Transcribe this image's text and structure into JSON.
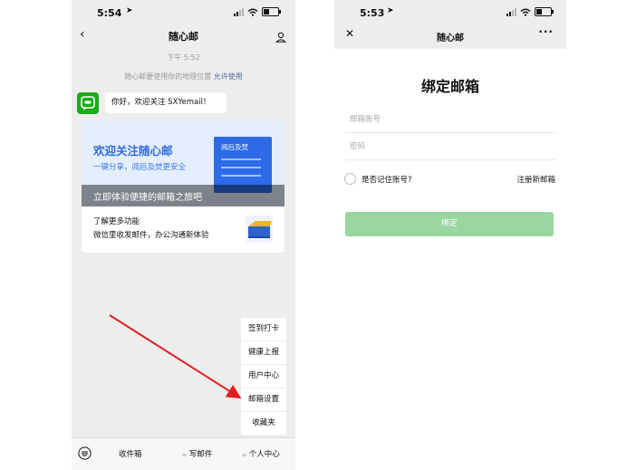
{
  "left_phone": {
    "status": {
      "time": "5:54"
    },
    "nav": {
      "title": "随心邮",
      "back_icon": "chevron-left-icon",
      "user_icon": "person-icon"
    },
    "chat": {
      "timestamp": "下午 5:52",
      "notice": "随心邮要使用你的地理位置",
      "notice_link": "允许使用",
      "greeting": "你好，欢迎关注 SXYemail！",
      "card": {
        "title": "欢迎关注随心邮",
        "subtitle": "一键分享，阅后及焚更安全",
        "doc_tag": "阅后及焚",
        "strip": "立即体验便捷的邮箱之旅吧",
        "line1": "了解更多功能",
        "line2": "微信里收发邮件，办公沟通新体验"
      }
    },
    "menu": [
      "签到打卡",
      "健康上报",
      "用户中心",
      "邮箱设置",
      "收藏夹"
    ],
    "bottom_tabs": [
      "收件箱",
      "写邮件",
      "个人中心"
    ],
    "colors": {
      "arrow": "#e02020",
      "app_green": "#1aad19",
      "brand_blue": "#2f6be0"
    }
  },
  "right_phone": {
    "status": {
      "time": "5:53"
    },
    "nav": {
      "title": "随心邮",
      "close_icon": "close-icon",
      "more_icon": "more-icon"
    },
    "form": {
      "title": "绑定邮箱",
      "account_placeholder": "邮箱账号",
      "password_placeholder": "密码",
      "remember_label": "是否记住账号?",
      "register_link": "注册新邮箱",
      "bind_button": "绑定"
    },
    "colors": {
      "button": "#99d6a0"
    }
  }
}
